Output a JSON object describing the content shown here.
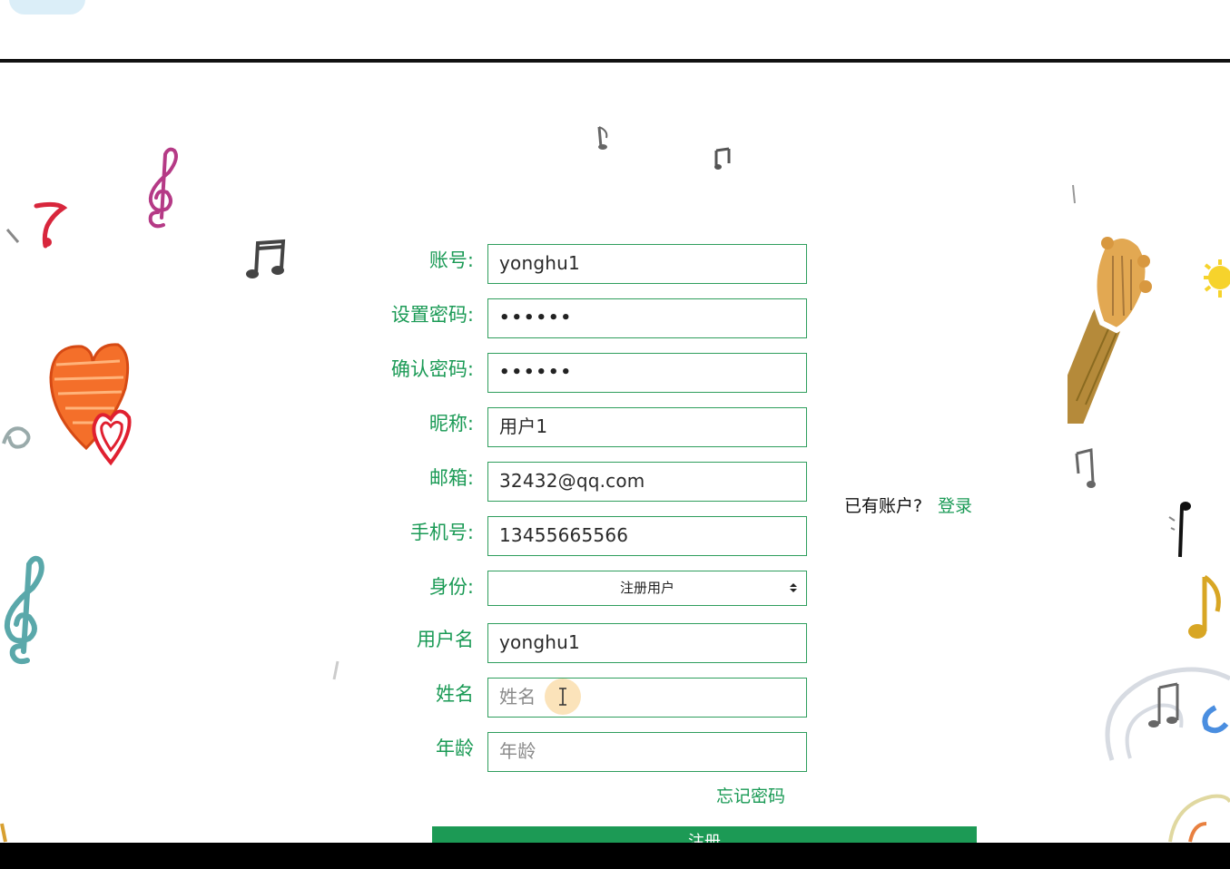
{
  "form": {
    "fields": [
      {
        "label": "账号:",
        "value": "yonghu1"
      },
      {
        "label": "设置密码:",
        "value": "••••••"
      },
      {
        "label": "确认密码:",
        "value": "••••••"
      },
      {
        "label": "昵称:",
        "value": "用户1"
      },
      {
        "label": "邮箱:",
        "value": "32432@qq.com"
      },
      {
        "label": "手机号:",
        "value": "13455665566"
      }
    ],
    "role": {
      "label": "身份:",
      "selected": "注册用户"
    },
    "username": {
      "label": "用户名",
      "value": "yonghu1"
    },
    "realname": {
      "label": "姓名",
      "placeholder": "姓名"
    },
    "age": {
      "label": "年龄",
      "placeholder": "年龄"
    },
    "forgot_password": "忘记密码",
    "register_button": "注册"
  },
  "login_prompt": {
    "text": "已有账户?",
    "link": "登录"
  },
  "colors": {
    "accent": "#1a9a55",
    "input_border": "#2f9e5d",
    "header_rule": "#111111"
  },
  "icons": [
    "treble-clef-icon",
    "music-note-icon",
    "heart-icon",
    "guitar-icon",
    "eighth-note-icon",
    "text-cursor-icon",
    "select-arrows-icon"
  ]
}
